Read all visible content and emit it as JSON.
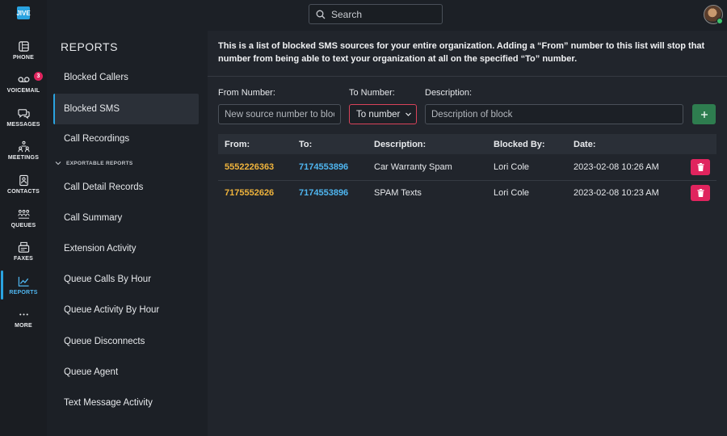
{
  "search": {
    "placeholder": "Search"
  },
  "rail": {
    "logo": "JIVE",
    "items": [
      {
        "label": "PHONE"
      },
      {
        "label": "VOICEMAIL",
        "badge": "3"
      },
      {
        "label": "MESSAGES"
      },
      {
        "label": "MEETINGS"
      },
      {
        "label": "CONTACTS"
      },
      {
        "label": "QUEUES"
      },
      {
        "label": "FAXES"
      },
      {
        "label": "REPORTS"
      },
      {
        "label": "MORE"
      }
    ]
  },
  "sidebar": {
    "title": "REPORTS",
    "items": [
      {
        "label": "Blocked Callers"
      },
      {
        "label": "Blocked SMS"
      },
      {
        "label": "Call Recordings"
      }
    ],
    "section_label": "EXPORTABLE REPORTS",
    "exportable": [
      {
        "label": "Call Detail Records"
      },
      {
        "label": "Call Summary"
      },
      {
        "label": "Extension Activity"
      },
      {
        "label": "Queue Calls By Hour"
      },
      {
        "label": "Queue Activity By Hour"
      },
      {
        "label": "Queue Disconnects"
      },
      {
        "label": "Queue Agent"
      },
      {
        "label": "Text Message Activity"
      }
    ]
  },
  "main": {
    "intro": "This is a list of blocked SMS sources for your entire organization. Adding a “From” number to this list will stop that number from being able to text your organization at all on the specified “To” number.",
    "form": {
      "from_label": "From Number:",
      "from_placeholder": "New source number to block",
      "to_label": "To Number:",
      "to_value": "To number",
      "desc_label": "Description:",
      "desc_placeholder": "Description of block"
    },
    "table": {
      "headers": {
        "from": "From:",
        "to": "To:",
        "description": "Description:",
        "blocked_by": "Blocked By:",
        "date": "Date:"
      },
      "rows": [
        {
          "from": "5552226363",
          "to": "7174553896",
          "description": "Car Warranty Spam",
          "blocked_by": "Lori Cole",
          "date": "2023-02-08 10:26 AM"
        },
        {
          "from": "7175552626",
          "to": "7174553896",
          "description": "SPAM Texts",
          "blocked_by": "Lori Cole",
          "date": "2023-02-08 10:23 AM"
        }
      ]
    }
  },
  "colors": {
    "accent": "#2aa3e0",
    "from_number": "#f0b43c",
    "to_number": "#4fb6f0",
    "delete": "#e0245e",
    "add": "#2e7d4f"
  }
}
